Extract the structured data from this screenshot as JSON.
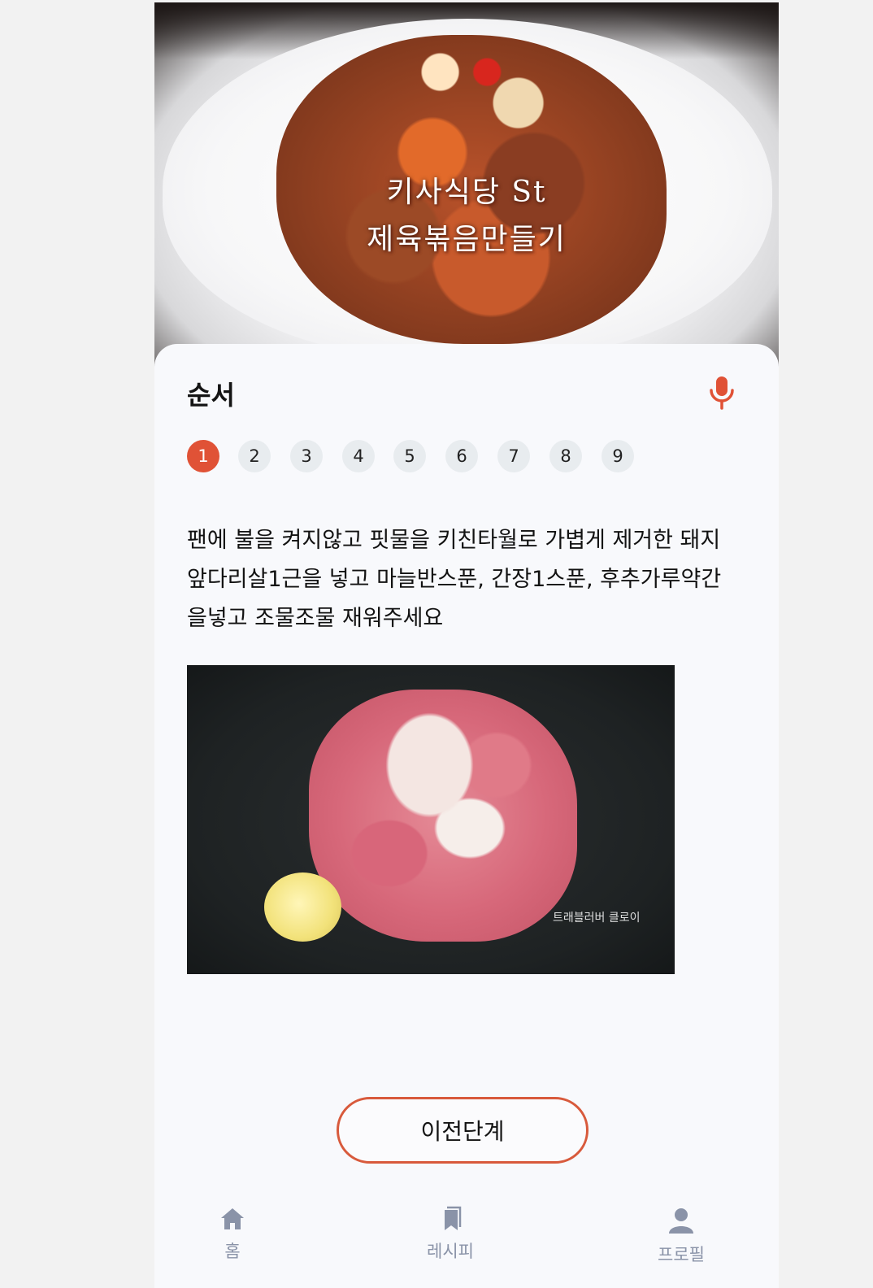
{
  "hero": {
    "image_name": "jeyuk-bokkeum-dish",
    "overlay_line1": "키사식당 St",
    "overlay_line2": "제육볶음만들기"
  },
  "steps_section": {
    "title": "순서",
    "mic_icon": "mic-icon",
    "accent_color": "#e05236",
    "steps": [
      "1",
      "2",
      "3",
      "4",
      "5",
      "6",
      "7",
      "8",
      "9"
    ],
    "active_step": "1",
    "instruction": "팬에 불을 켜지않고 핏물을 키친타월로 가볍게 제거한 돼지앞다리살1근을 넣고 마늘반스푼, 간장1스푼, 후추가루약간을넣고 조물조물 재워주세요",
    "photo_watermark": "트래블러버 클로이"
  },
  "buttons": {
    "prev_label": "이전단계"
  },
  "tabbar": {
    "icon_color": "#8a93a8",
    "items": [
      {
        "label": "홈",
        "icon": "home-icon"
      },
      {
        "label": "레시피",
        "icon": "bookmark-icon"
      },
      {
        "label": "프로필",
        "icon": "profile-icon"
      }
    ]
  }
}
